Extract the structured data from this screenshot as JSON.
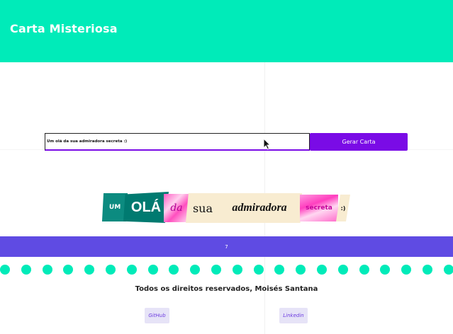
{
  "header": {
    "title": "Carta Misteriosa",
    "background": "#00ebb9"
  },
  "form": {
    "input_value": "Um olá da sua admiradora secreta :)",
    "button_label": "Gerar Carta",
    "accent": "#7a0be6"
  },
  "letter": {
    "words": [
      "UM",
      "OLÁ",
      "da",
      "sua",
      "admiradora",
      "secreta",
      ":)"
    ]
  },
  "counter": {
    "value": "7",
    "background": "#5f4be3"
  },
  "footer": {
    "copyright": "Todos os direitos reservados, Moisés Santana",
    "links": [
      "GitHub",
      "Linkedin"
    ]
  },
  "icons": {
    "cursor": "mouse-pointer-icon"
  }
}
